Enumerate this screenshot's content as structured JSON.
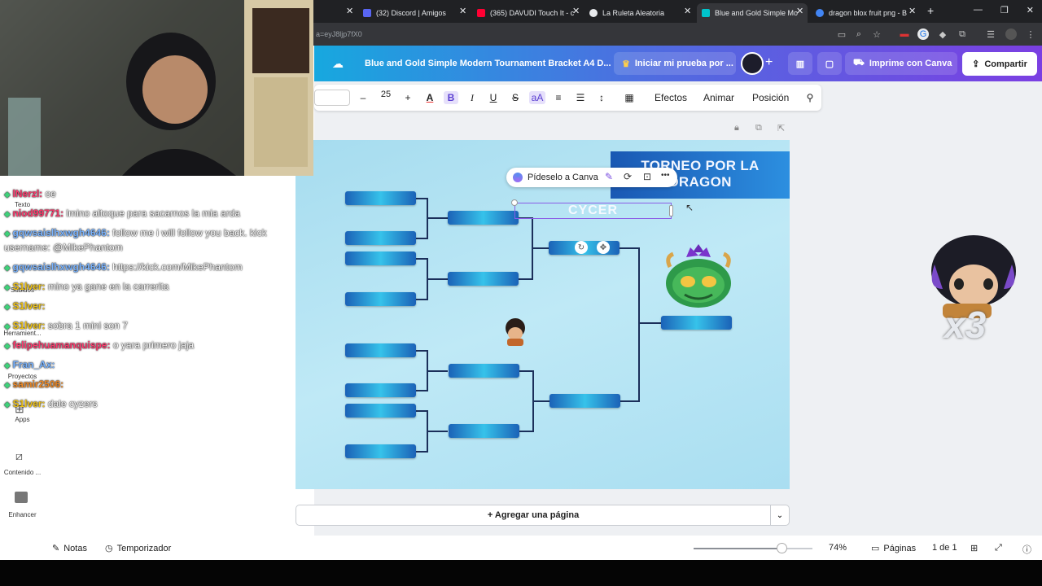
{
  "browser": {
    "tabs": [
      {
        "label": "(32) Discord | Amigos",
        "color": "#5865f2"
      },
      {
        "label": "(365) DAVUDI Touch It - c",
        "color": "#ff0033"
      },
      {
        "label": "La Ruleta Aleatoria",
        "color": "#f0f0f0"
      },
      {
        "label": "Blue and Gold Simple Mo",
        "color": "#00c4cc"
      },
      {
        "label": "dragon blox fruit png - B",
        "color": "#4285f4"
      }
    ],
    "new_tab": "+",
    "url": "a=eyJ8ljp7fX0",
    "window_controls": [
      "—",
      "❐",
      "✕"
    ]
  },
  "canva": {
    "doc_title": "Blue and Gold Simple Modern Tournament Bracket A4 D...",
    "trial_button": "Iniciar mi prueba por ...",
    "print_button": "Imprime con Canva",
    "share_button": "Compartir",
    "toolbar": {
      "font_size": "25",
      "minus": "–",
      "plus": "+",
      "bold": "B",
      "italic": "I",
      "underline": "U",
      "strike": "S",
      "case": "aA",
      "effects": "Efectos",
      "animate": "Animar",
      "position": "Posición"
    },
    "context_menu": {
      "ask_canva": "Pídeselo a Canva",
      "more": "•••"
    },
    "canvas": {
      "title": "TORNEO POR LA DRAGON",
      "winner_text": "CYCER"
    },
    "add_page": "+ Agregar una página",
    "footer": {
      "notes": "Notas",
      "timer": "Temporizador",
      "zoom": "74%",
      "pages_label": "Páginas",
      "page_count": "1 de 1",
      "zoom_fraction": 0.74
    },
    "left_rail": {
      "texto": "Texto",
      "subidos": "Subidos",
      "herramientas": "Herramient...",
      "proyectos": "Proyectos",
      "apps": "Apps",
      "contenido": "Contenido ...",
      "enhancer": "Enhancer"
    }
  },
  "overlay": {
    "x3": "x3",
    "chat": [
      {
        "user": "lNerzl:",
        "msg": " oe",
        "color": "#ff3a6e"
      },
      {
        "user": "niod99771:",
        "msg": " lmino altoque para sacarnos la mia arda",
        "color": "#ff3a6e"
      },
      {
        "user": "gqwsaislhxwgh4646:",
        "msg": " follow me i will follow you back. kick",
        "color": "#7ab4ff"
      },
      {
        "user": "",
        "msg": "username: @MikePhantom",
        "color": "#ffffff"
      },
      {
        "user": "gqwsaislhxwgh4646:",
        "msg": " https://kick.com/MikePhantom",
        "color": "#7ab4ff"
      },
      {
        "user": "S1lver:",
        "msg": " mino ya gane en la carrerita",
        "color": "#f0c419"
      },
      {
        "user": "S1lver:",
        "msg": " ",
        "color": "#f0c419"
      },
      {
        "user": "S1lver:",
        "msg": " sobra 1 mini son 7",
        "color": "#f0c419"
      },
      {
        "user": "felipehuamanquispe:",
        "msg": " o yara primero jaja",
        "color": "#ff3a6e"
      },
      {
        "user": "Fran_Ax:",
        "msg": " ",
        "color": "#7ab4ff"
      },
      {
        "user": "samir2506:",
        "msg": " ",
        "color": "#f08a24"
      },
      {
        "user": "S1lver:",
        "msg": " dale cyzers",
        "color": "#f0c419"
      }
    ]
  }
}
